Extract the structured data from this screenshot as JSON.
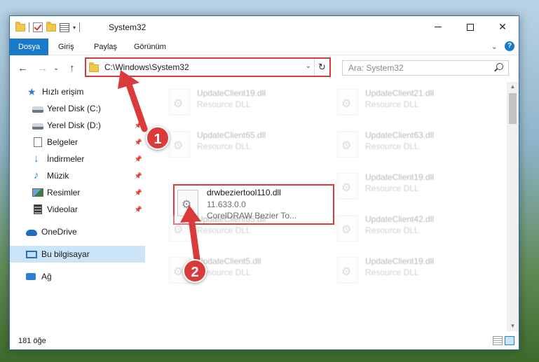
{
  "window": {
    "title": "System32",
    "controls": {
      "minimize_icon": "minimize-icon",
      "maximize_icon": "maximize-icon",
      "close": "✕"
    }
  },
  "ribbon": {
    "tabs": [
      {
        "label": "Dosya",
        "active": true
      },
      {
        "label": "Giriş",
        "active": false
      },
      {
        "label": "Paylaş",
        "active": false
      },
      {
        "label": "Görünüm",
        "active": false
      }
    ],
    "expand_glyph": "⌄",
    "help_glyph": "?"
  },
  "nav": {
    "back": "←",
    "forward": "→",
    "recent": "⌄",
    "up": "↑",
    "address": "C:\\Windows\\System32",
    "address_dropdown": "⌄",
    "refresh": "↻",
    "search_placeholder": "Ara: System32"
  },
  "sidebar": {
    "items": [
      {
        "label": "Hızlı erişim",
        "icon": "star-icon",
        "glyph": "★",
        "pinned": false
      },
      {
        "label": "Yerel Disk (C:)",
        "icon": "drive-icon",
        "glyph": "",
        "pinned": false
      },
      {
        "label": "Yerel Disk (D:)",
        "icon": "drive-icon",
        "glyph": "",
        "pinned": true
      },
      {
        "label": "Belgeler",
        "icon": "document-icon",
        "glyph": "",
        "pinned": true
      },
      {
        "label": "İndirmeler",
        "icon": "download-icon",
        "glyph": "↓",
        "pinned": true
      },
      {
        "label": "Müzik",
        "icon": "music-icon",
        "glyph": "♪",
        "pinned": true
      },
      {
        "label": "Resimler",
        "icon": "pictures-icon",
        "glyph": "",
        "pinned": true
      },
      {
        "label": "Videolar",
        "icon": "videos-icon",
        "glyph": "",
        "pinned": true
      },
      {
        "label": "OneDrive",
        "icon": "onedrive-icon",
        "glyph": "",
        "pinned": false
      },
      {
        "label": "Bu bilgisayar",
        "icon": "this-pc-icon",
        "glyph": "",
        "pinned": false,
        "selected": true
      },
      {
        "label": "Ağ",
        "icon": "network-icon",
        "glyph": "",
        "pinned": false
      }
    ],
    "pin_glyph": "📌"
  },
  "files": [
    {
      "name": "UpdateClient19.dll",
      "desc": "Resource DLL",
      "faded": true
    },
    {
      "name": "UpdateClient21.dll",
      "desc": "Resource DLL",
      "faded": true
    },
    {
      "name": "UpdateClient65.dll",
      "desc": "Resource DLL",
      "faded": true
    },
    {
      "name": "UpdateClient63.dll",
      "desc": "Resource DLL",
      "faded": true
    },
    {
      "name": "drwbeziertool110.dll",
      "version": "11.633.0.0",
      "desc": "CorelDRAW Bezier To...",
      "highlighted": true
    },
    {
      "name": "UpdateClient19.dll",
      "desc": "Resource DLL",
      "faded": true
    },
    {
      "name": "UpdateClient65.dll",
      "desc": "Resource DLL",
      "faded": true
    },
    {
      "name": "UpdateClient42.dll",
      "desc": "Resource DLL",
      "faded": true
    },
    {
      "name": "UpdateClient5.dll",
      "desc": "Resource DLL",
      "faded": true
    },
    {
      "name": "UpdateClient19.dll",
      "desc": "Resource DLL",
      "faded": true
    }
  ],
  "status": {
    "count": "181 öğe"
  },
  "annotations": [
    {
      "number": "1",
      "color": "#d93a3a"
    },
    {
      "number": "2",
      "color": "#d93a3a"
    }
  ]
}
